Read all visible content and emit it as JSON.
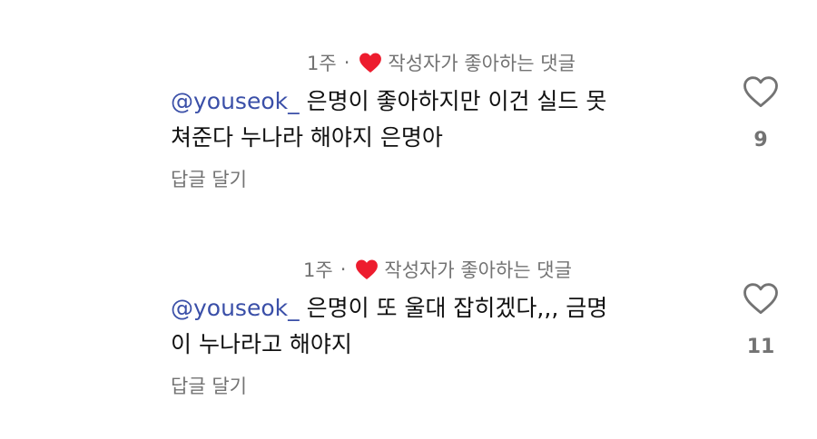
{
  "colors": {
    "liked_heart": "#ed1c2e",
    "mention": "#3a4fa8",
    "meta_text": "#737373",
    "body_text": "#111111"
  },
  "comments": [
    {
      "time": "1주",
      "separator": "·",
      "author_liked_label": "작성자가 좋아하는 댓글",
      "mention": "@youseok_",
      "line1": "은명이 좋아하지만 이건 실드 못",
      "line2": "쳐준다 누나라 해야지 은명아",
      "reply_label": "답글 달기",
      "like_icon": "heart-outline-icon",
      "like_count": "9"
    },
    {
      "time": "1주",
      "separator": "·",
      "author_liked_label": "작성자가 좋아하는 댓글",
      "mention": "@youseok_",
      "line1": "은명이 또 울대 잡히겠다,,, 금명",
      "line2": "이 누나라고 해야지",
      "reply_label": "답글 달기",
      "like_icon": "heart-outline-icon",
      "like_count": "11"
    }
  ]
}
